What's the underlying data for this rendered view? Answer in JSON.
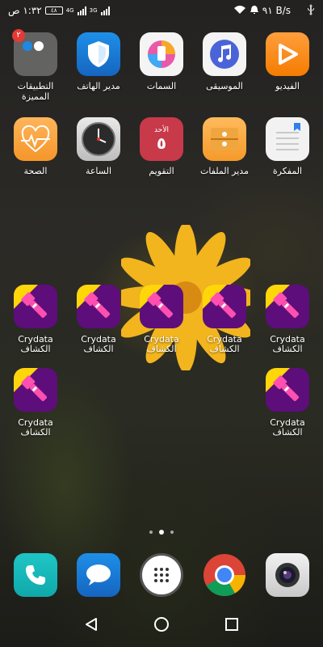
{
  "status_bar": {
    "time": "١:٣٢ ص",
    "battery": "٤٨",
    "network_4g": "4G",
    "network_3g": "3G",
    "speed": "٩١ B/s"
  },
  "row1": [
    {
      "label": "التطبيقات المميزة",
      "badge": "٢"
    },
    {
      "label": "مدير الهاتف"
    },
    {
      "label": "السمات"
    },
    {
      "label": "الموسيقى"
    },
    {
      "label": "الفيديو"
    }
  ],
  "row2": [
    {
      "label": "الصحة"
    },
    {
      "label": "الساعة"
    },
    {
      "label": "التقويم",
      "day_name": "الأحد",
      "day_num": "٥"
    },
    {
      "label": "مدير الملفات"
    },
    {
      "label": "المفكرة"
    }
  ],
  "torch_label_line1": "Crydata",
  "torch_label_line2": "الكشاف",
  "colors": {
    "torch_bg": "#5d0e7a",
    "torch_pink": "#ff4fb0",
    "badge": "#e53935"
  },
  "dock": [
    {
      "name": "phone"
    },
    {
      "name": "messages"
    },
    {
      "name": "app-drawer"
    },
    {
      "name": "chrome"
    },
    {
      "name": "camera"
    }
  ]
}
